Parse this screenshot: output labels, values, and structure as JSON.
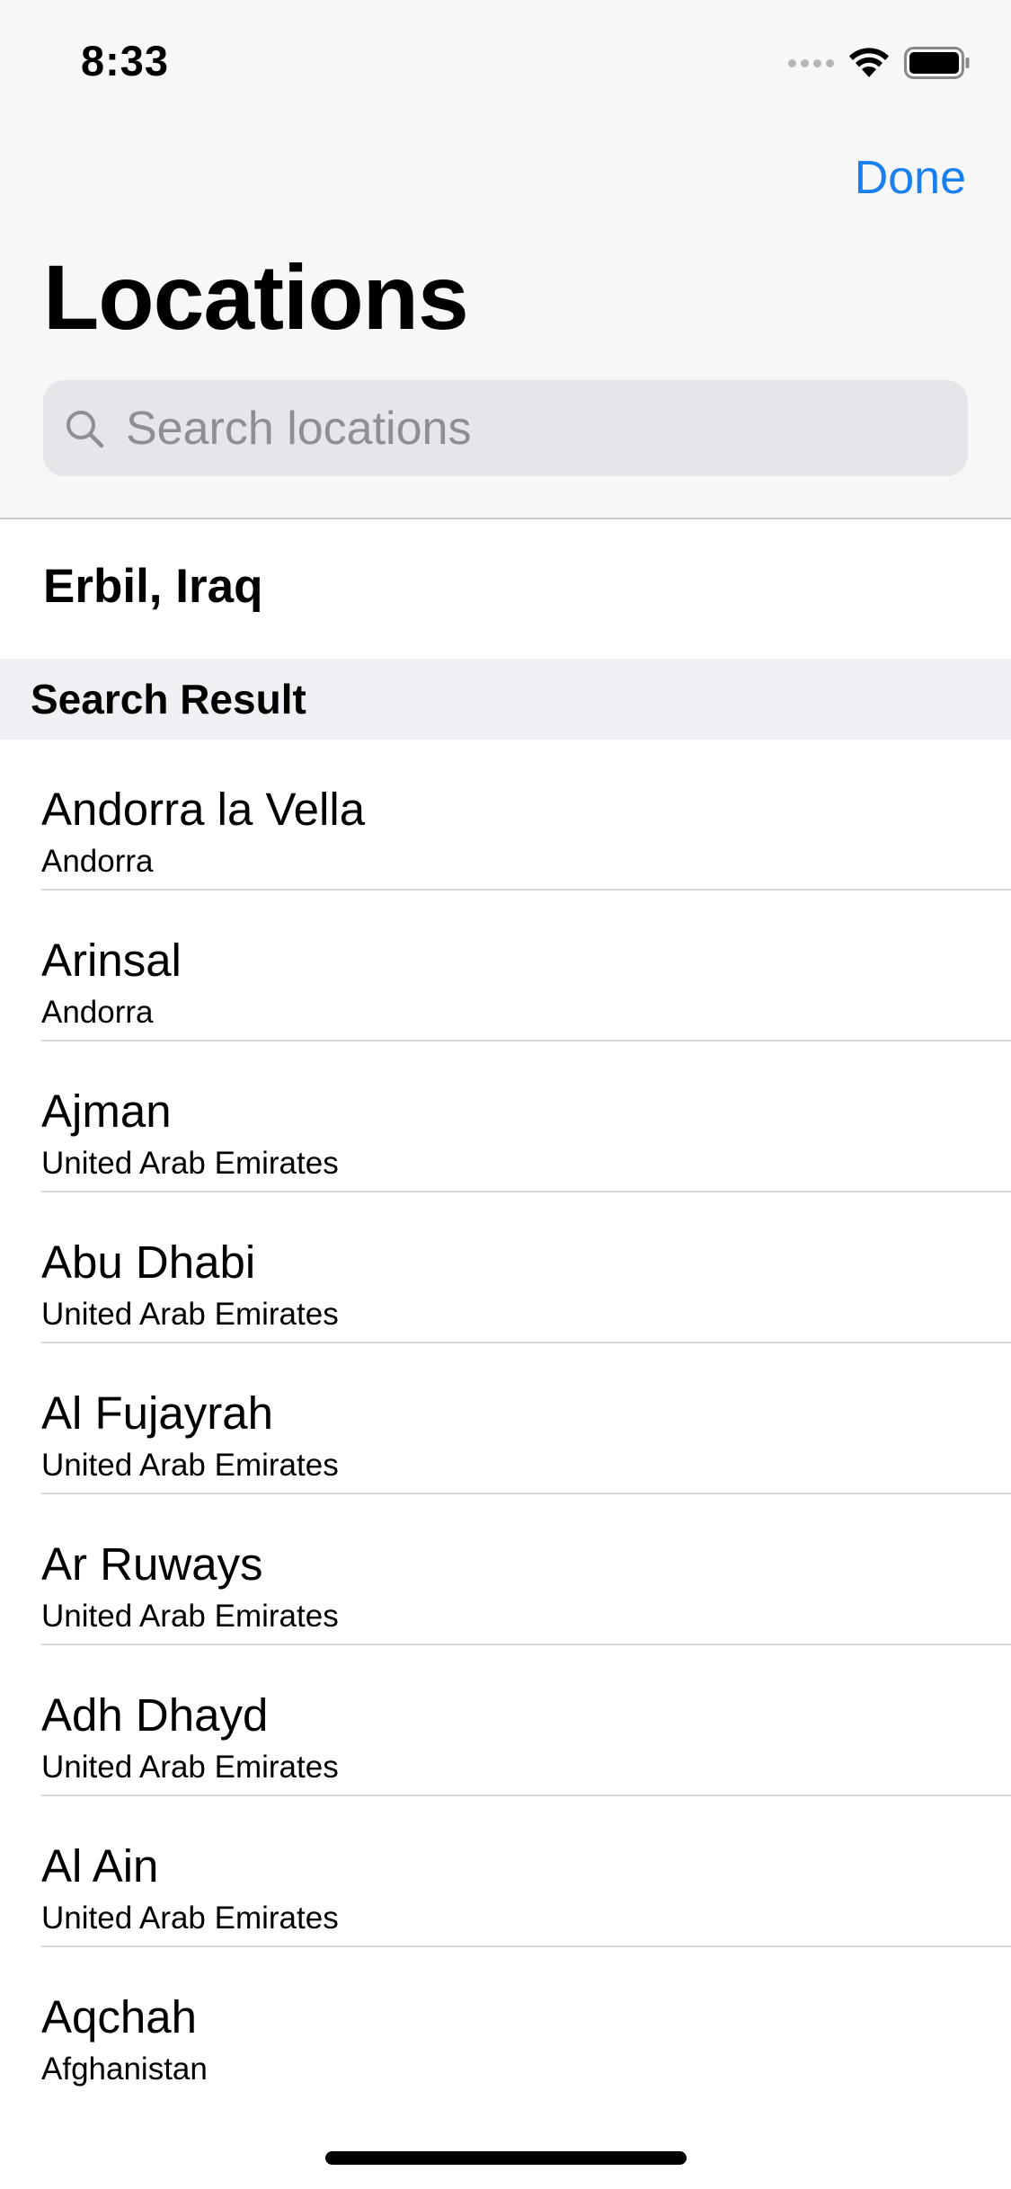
{
  "status_bar": {
    "time": "8:33",
    "icons": [
      "signal-dots-icon",
      "wifi-icon",
      "battery-icon"
    ]
  },
  "nav": {
    "done_label": "Done",
    "title": "Locations"
  },
  "search": {
    "placeholder": "Search locations",
    "value": ""
  },
  "current_location": "Erbil, Iraq",
  "section_header": "Search Result",
  "results": [
    {
      "city": "Andorra la Vella",
      "country": "Andorra"
    },
    {
      "city": "Arinsal",
      "country": "Andorra"
    },
    {
      "city": "Ajman",
      "country": "United Arab Emirates"
    },
    {
      "city": "Abu Dhabi",
      "country": "United Arab Emirates"
    },
    {
      "city": "Al Fujayrah",
      "country": "United Arab Emirates"
    },
    {
      "city": "Ar Ruways",
      "country": "United Arab Emirates"
    },
    {
      "city": "Adh Dhayd",
      "country": "United Arab Emirates"
    },
    {
      "city": "Al Ain",
      "country": "United Arab Emirates"
    },
    {
      "city": "Aqchah",
      "country": "Afghanistan"
    }
  ],
  "colors": {
    "accent": "#1a7ff0",
    "header_bg": "#f7f7f8",
    "search_bg": "#e5e5ea",
    "section_bg": "#efeff4",
    "placeholder": "#8e8e93"
  }
}
